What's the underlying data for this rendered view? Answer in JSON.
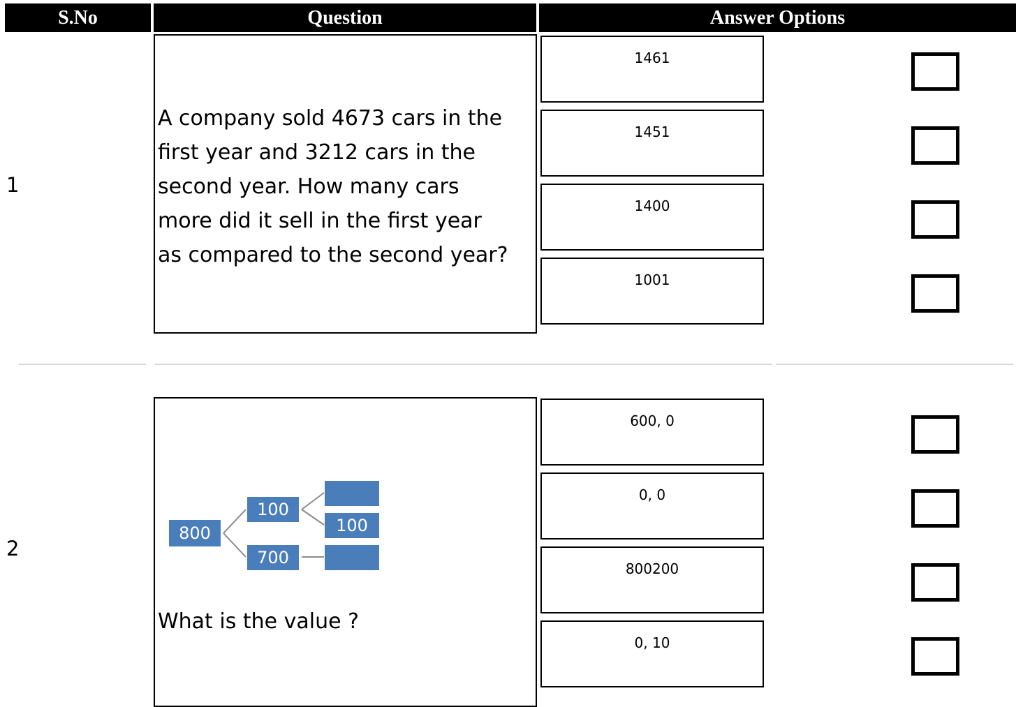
{
  "header": {
    "sno": "S.No",
    "question": "Question",
    "answer_options": "Answer Options"
  },
  "questions": [
    {
      "sno": "1",
      "text_lines": [
        "A company sold 4673 cars in the",
        "first year and 3212 cars in the",
        "second year. How many cars",
        "more did it sell in the first year",
        "as compared to the second year?"
      ],
      "options": [
        "1461",
        "1451",
        "1400",
        "1001"
      ]
    },
    {
      "sno": "2",
      "diagram": {
        "root": "800",
        "upper": "100",
        "lower": "700",
        "upper_right_1": "",
        "upper_right_2": "100",
        "lower_right": ""
      },
      "text": "What is the value ?",
      "options": [
        "600, 0",
        "0, 0",
        "800200",
        "0, 10"
      ]
    }
  ],
  "colors": {
    "header_bg": "#000000",
    "diagram_box": "#4a7ebb"
  }
}
